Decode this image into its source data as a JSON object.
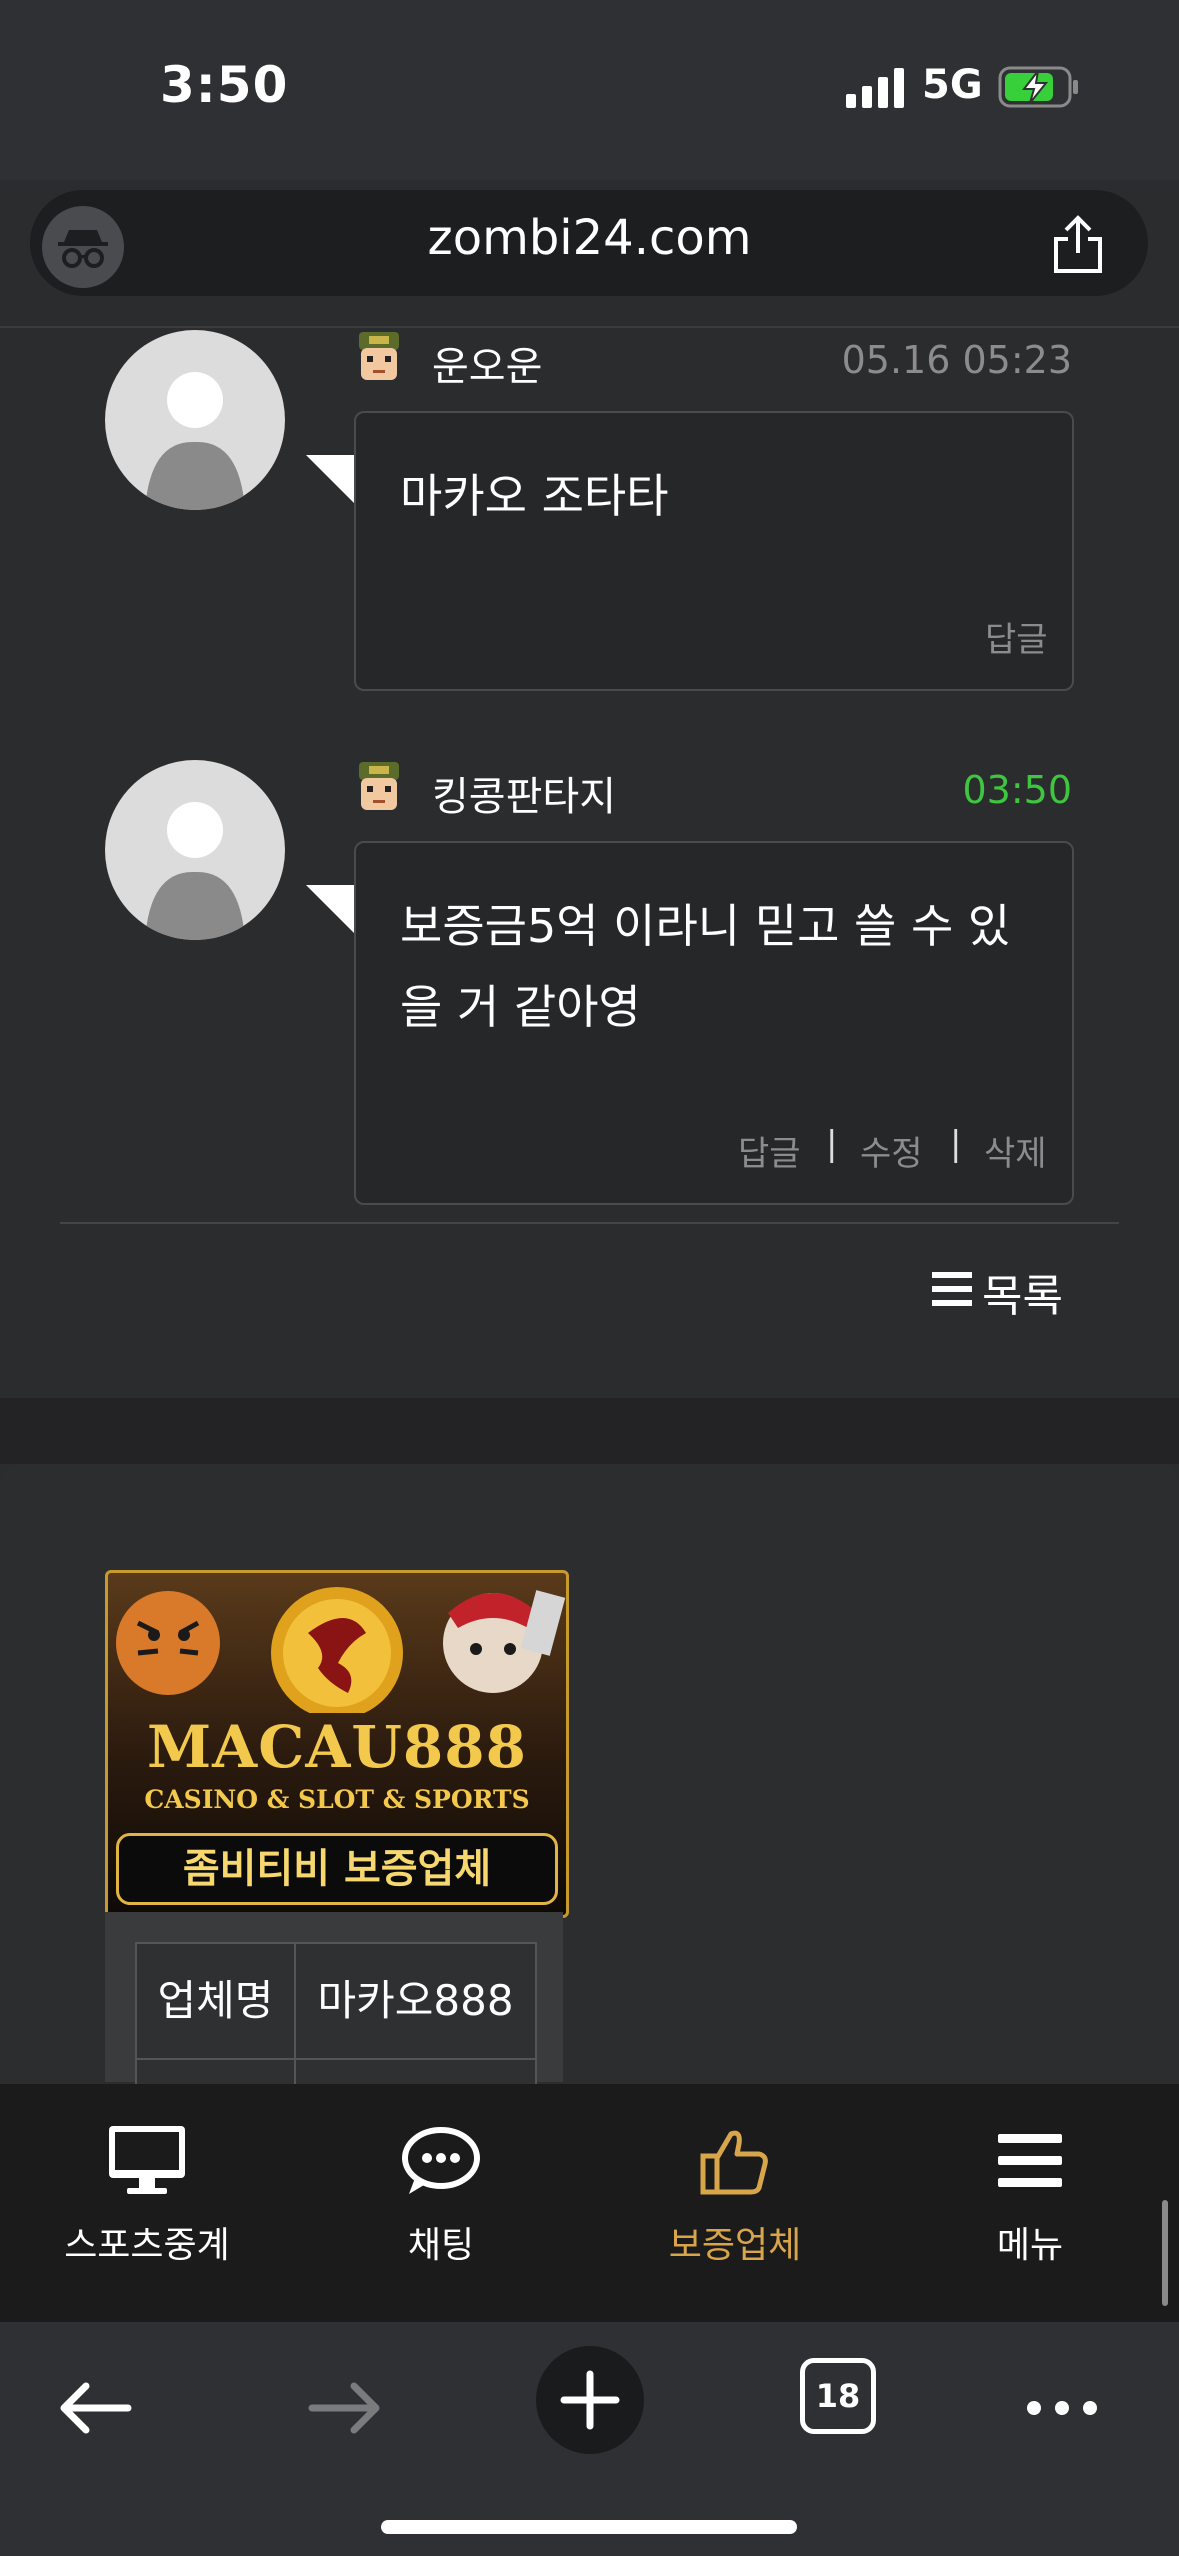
{
  "status_bar": {
    "time": "3:50",
    "network": "5G"
  },
  "url_bar": {
    "url": "zombi24.com"
  },
  "comments": [
    {
      "user": "운오운",
      "time": "05.16 05:23",
      "text": "마카오 조타타",
      "actions": [
        "답글"
      ]
    },
    {
      "user": "킹콩판타지",
      "time": "03:50",
      "text_lines": [
        "보증금5억 이라니 믿고 쓸 수 있",
        "을 거 같아영"
      ],
      "actions": [
        "답글",
        "수정",
        "삭제"
      ]
    }
  ],
  "action_separator": "|",
  "list_button": {
    "label": "목록"
  },
  "banner": {
    "brand": "MACAU888",
    "subtitle": "CASINO & SLOT & SPORTS",
    "tag": "좀비티비 보증업체"
  },
  "info_table": {
    "key": "업체명",
    "value": "마카오888"
  },
  "site_nav": [
    {
      "label": "스포츠중계",
      "icon": "monitor-icon",
      "active": false
    },
    {
      "label": "채팅",
      "icon": "chat-icon",
      "active": false
    },
    {
      "label": "보증업체",
      "icon": "thumbs-up-icon",
      "active": true
    },
    {
      "label": "메뉴",
      "icon": "menu-icon",
      "active": false
    }
  ],
  "browser_toolbar": {
    "tab_count": "18"
  },
  "colors": {
    "accent_active": "#d9a54a",
    "new_time": "#3ec63e",
    "banner_gold": "#f3c94d"
  }
}
